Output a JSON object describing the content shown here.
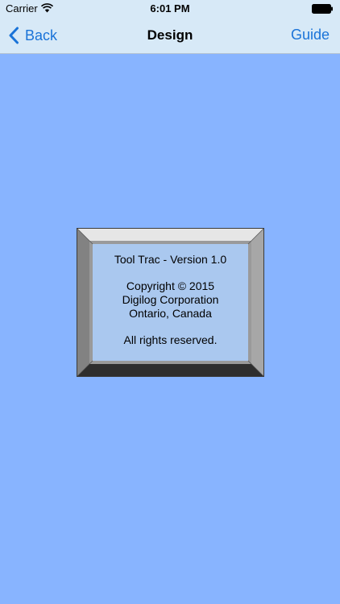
{
  "status_bar": {
    "carrier": "Carrier",
    "time": "6:01 PM"
  },
  "nav_bar": {
    "back_label": "Back",
    "title": "Design",
    "guide_label": "Guide"
  },
  "about_panel": {
    "version_line": "Tool Trac - Version 1.0",
    "copyright_line": "Copyright © 2015",
    "company_line": "Digilog Corporation",
    "location_line": "Ontario, Canada",
    "rights_line": "All rights reserved."
  },
  "colors": {
    "background": "#88b4ff",
    "nav_background": "#d7e9f7",
    "accent": "#1a73d8",
    "panel_face": "#aac8ef"
  }
}
